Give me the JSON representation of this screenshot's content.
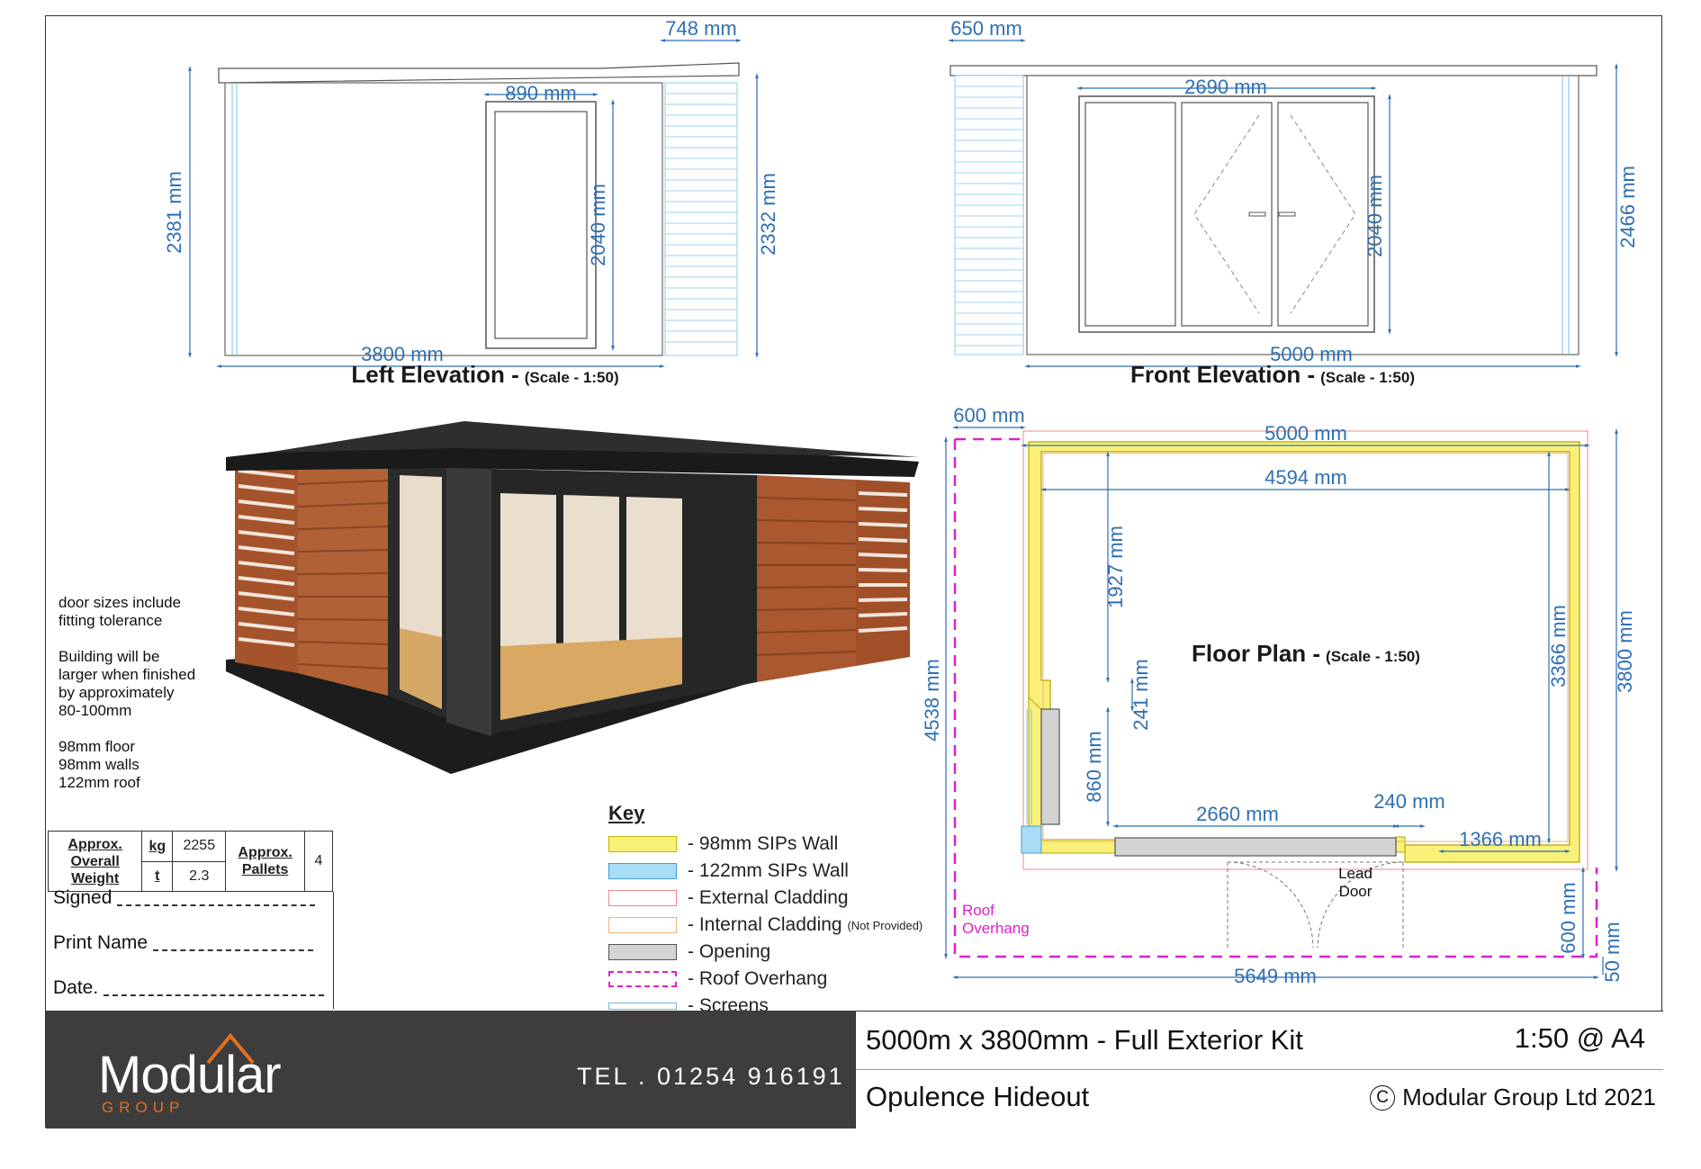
{
  "left_elevation": {
    "title": "Left Elevation -",
    "scale": "(Scale - 1:50)",
    "dims": [
      "748 mm",
      "890 mm",
      "2381 mm",
      "2040 mm",
      "2332 mm",
      "3800 mm"
    ]
  },
  "front_elevation": {
    "title": "Front Elevation -",
    "scale": "(Scale - 1:50)",
    "dims": [
      "650 mm",
      "2690 mm",
      "2040 mm",
      "2466 mm",
      "5000 mm"
    ]
  },
  "floor_plan": {
    "title": "Floor Plan -",
    "scale": "(Scale - 1:50)",
    "dims": [
      "600 mm",
      "5000 mm",
      "4594 mm",
      "1927 mm",
      "241 mm",
      "3366 mm",
      "3800 mm",
      "4538 mm",
      "860 mm",
      "2660 mm",
      "240 mm",
      "1366 mm",
      "600 mm",
      "50 mm",
      "5649 mm"
    ],
    "roof_overhang_label": [
      "Roof",
      "Overhang"
    ],
    "lead_door_label": [
      "Lead",
      "Door"
    ]
  },
  "notes": [
    [
      "door sizes include",
      "fitting tolerance"
    ],
    [
      "Building will be",
      "larger when finished",
      "by approximately",
      "80-100mm"
    ],
    [
      "98mm floor",
      "98mm walls",
      "122mm roof"
    ]
  ],
  "weight": {
    "approx_overall_weight": [
      "Approx.",
      "Overall",
      "Weight"
    ],
    "kg_label": "kg",
    "kg_value": "2255",
    "t_label": "t",
    "t_value": "2.3",
    "approx_pallets": [
      "Approx.",
      "Pallets"
    ],
    "pallets_value": "4"
  },
  "signoff": {
    "signed": "Signed",
    "print_name": "Print Name",
    "date": "Date."
  },
  "key": {
    "title": "Key",
    "items": [
      {
        "label": "- 98mm SIPs Wall",
        "color": "#f9f07a",
        "border": "#c9b400",
        "style": "solid"
      },
      {
        "label": "- 122mm SIPs Wall",
        "color": "#a9dcf5",
        "border": "#4a9bd1",
        "style": "solid"
      },
      {
        "label": "- External Cladding",
        "color": "#ffffff",
        "border": "#e88",
        "style": "solid"
      },
      {
        "label": "- Internal Cladding",
        "note": "(Not Provided)",
        "color": "#ffffff",
        "border": "#f1b27a",
        "style": "solid"
      },
      {
        "label": "- Opening",
        "color": "#d4d4d4",
        "border": "#555",
        "style": "solid"
      },
      {
        "label": "- Roof Overhang",
        "color": "#ffffff",
        "border": "#e020d0",
        "style": "dashed"
      },
      {
        "label": "- Screens",
        "color": "#ffffff",
        "border": "#6fb6dc",
        "style": "screen"
      }
    ]
  },
  "footer": {
    "logo": "Modular",
    "logo_sub": "GROUP",
    "tel": "TEL . 01254 916191",
    "product": "5000m x 3800mm - Full Exterior Kit",
    "scale": "1:50 @ A4",
    "name": "Opulence Hideout",
    "copyright": "Modular Group Ltd 2021",
    "copyright_symbol": "C"
  },
  "colors": {
    "dimension": "#2f6fb3",
    "sips_wall": "#f9f07a",
    "roof_overhang": "#e020d0",
    "footer_dark": "#3d3d3d",
    "logo_accent": "#e07020"
  }
}
